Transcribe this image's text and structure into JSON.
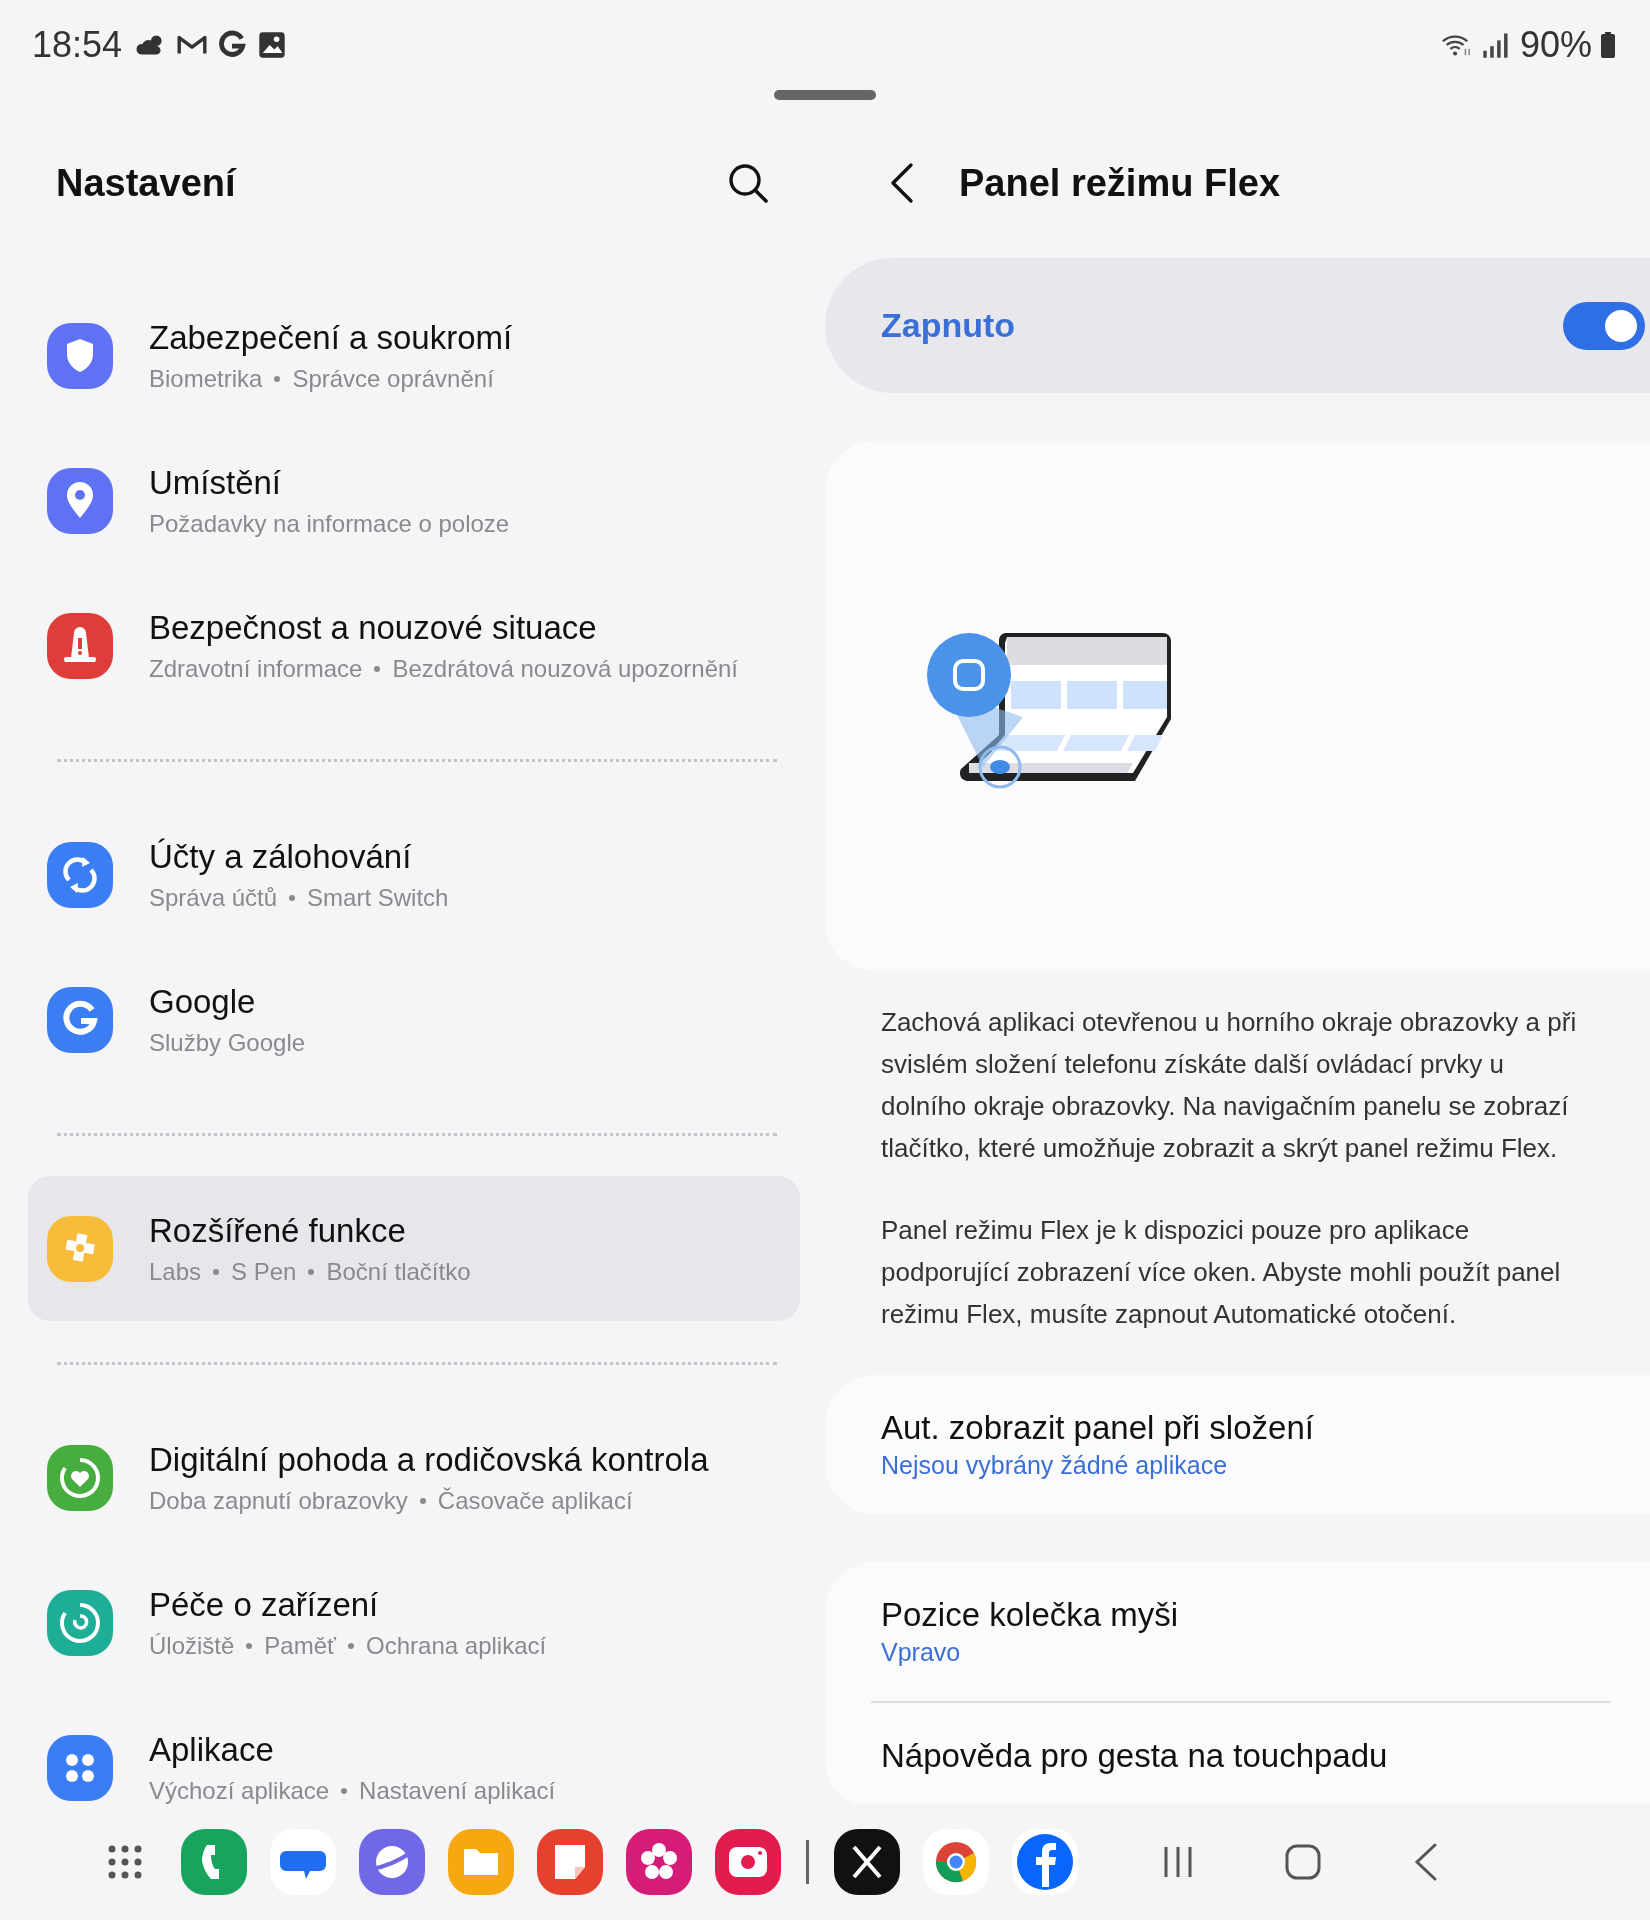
{
  "status_bar": {
    "time": "18:54",
    "battery": "90%"
  },
  "settings": {
    "title": "Nastavení",
    "sections": [
      [
        {
          "title": "Zabezpečení a soukromí",
          "subtitle": [
            "Biometrika",
            "Správce oprávnění"
          ],
          "color": "#5f72f3",
          "selected": false
        },
        {
          "title": "Umístění",
          "subtitle": [
            "Požadavky na informace o poloze"
          ],
          "color": "#5f72f3",
          "selected": false
        },
        {
          "title": "Bezpečnost a nouzové situace",
          "subtitle": [
            "Zdravotní informace",
            "Bezdrátová nouzová upozornění"
          ],
          "color": "#de3d3a",
          "selected": false
        }
      ],
      [
        {
          "title": "Účty a zálohování",
          "subtitle": [
            "Správa účtů",
            "Smart Switch"
          ],
          "color": "#3b7df3",
          "selected": false
        },
        {
          "title": "Google",
          "subtitle": [
            "Služby Google"
          ],
          "color": "#3b7df3",
          "selected": false
        }
      ],
      [
        {
          "title": "Rozšířené funkce",
          "subtitle": [
            "Labs",
            "S Pen",
            "Boční tlačítko"
          ],
          "color": "#f9bb3a",
          "selected": true
        }
      ],
      [
        {
          "title": "Digitální pohoda a rodičovská kontrola",
          "subtitle": [
            "Doba zapnutí obrazovky",
            "Časovače aplikací"
          ],
          "color": "#47ad3e",
          "selected": false
        },
        {
          "title": "Péče o zařízení",
          "subtitle": [
            "Úložiště",
            "Paměť",
            "Ochrana aplikací"
          ],
          "color": "#1eae97",
          "selected": false
        },
        {
          "title": "Aplikace",
          "subtitle": [
            "Výchozí aplikace",
            "Nastavení aplikací"
          ],
          "color": "#3b7df3",
          "selected": false
        }
      ]
    ]
  },
  "detail": {
    "title": "Panel režimu Flex",
    "switch": {
      "label": "Zapnuto",
      "on": true
    },
    "description": [
      "Zachová aplikaci otevřenou u horního okraje obrazovky a při svislém složení telefonu získáte další ovládací prvky u dolního okraje obrazovky. Na navigačním panelu se zobrazí tlačítko, které umožňuje zobrazit a skrýt panel režimu Flex.",
      "Panel režimu Flex je k dispozici pouze pro aplikace podporující zobrazení více oken. Abyste mohli použít panel režimu Flex, musíte zapnout Automatické otočení."
    ],
    "cards": [
      [
        {
          "title": "Aut. zobrazit panel při složení",
          "value": "Nejsou vybrány žádné aplikace"
        }
      ],
      [
        {
          "title": "Pozice kolečka myši",
          "value": "Vpravo"
        },
        {
          "title": "Nápověda pro gesta na touchpadu"
        }
      ]
    ]
  }
}
